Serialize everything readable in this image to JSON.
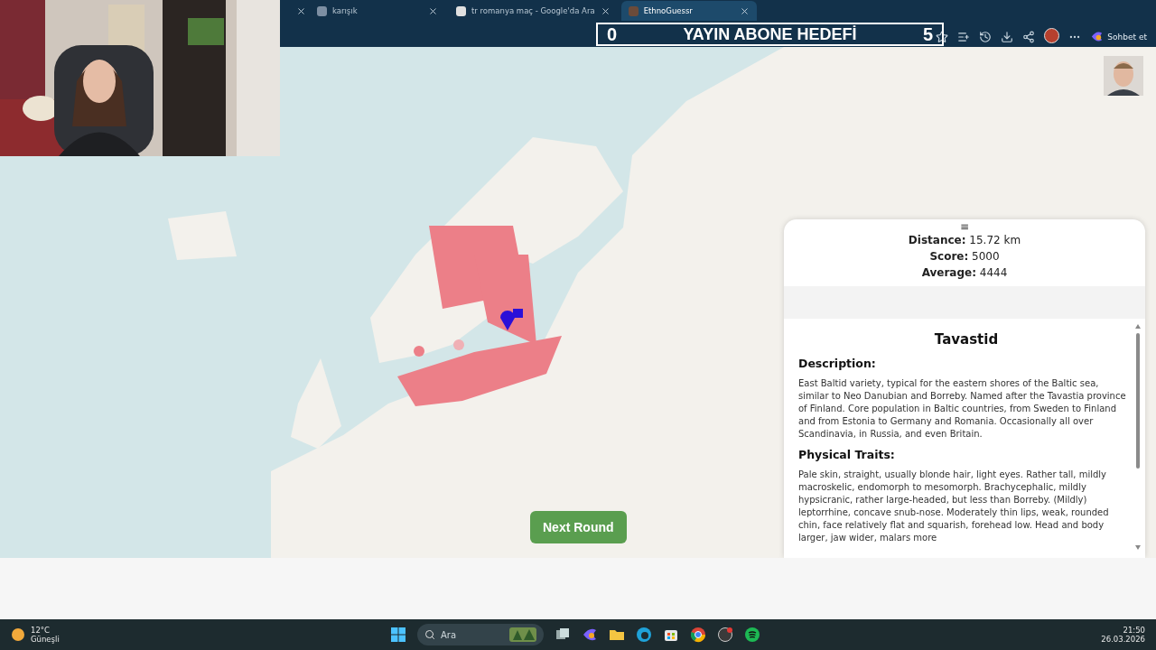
{
  "browser": {
    "tabs": [
      {
        "title": "karışık",
        "selected": false
      },
      {
        "title": "tr romanya maç - Google'da Ara",
        "selected": false
      },
      {
        "title": "EthnoGuessr",
        "selected": true
      }
    ],
    "copilot_label": "Sohbet et"
  },
  "stream_overlay": {
    "current": "0",
    "title": "YAYIN ABONE HEDEFİ",
    "goal": "5"
  },
  "next_button": "Next Round",
  "result_panel": {
    "handle": "≡",
    "stats": [
      {
        "label": "Distance:",
        "value": "15.72 km"
      },
      {
        "label": "Score:",
        "value": "5000"
      },
      {
        "label": "Average:",
        "value": "4444"
      }
    ],
    "title": "Tavastid",
    "sections": [
      {
        "heading": "Description:",
        "text": "East Baltid variety, typical for the eastern shores of the Baltic sea, similar to Neo Danubian and Borreby. Named after the Tavastia province of Finland. Core population in Baltic countries, from Sweden to Finland and from Estonia to Germany and Romania. Occasionally all over Scandinavia, in Russia, and even Britain."
      },
      {
        "heading": "Physical Traits:",
        "text": "Pale skin, straight, usually blonde hair, light eyes. Rather tall, mildly macroskelic, endomorph to mesomorph. Brachycephalic, mildly hypsicranic, rather large-headed, but less than Borreby. (Mildly) leptorrhine, concave snub-nose. Moderately thin lips, weak, rounded chin, face relatively flat and squarish, forehead low. Head and body larger, jaw wider, malars more"
      }
    ]
  },
  "taskbar": {
    "weather": {
      "temperature": "12°C",
      "condition": "Güneşli"
    },
    "search_placeholder": "Ara",
    "time": "21:50",
    "date": "26.03.2026"
  }
}
